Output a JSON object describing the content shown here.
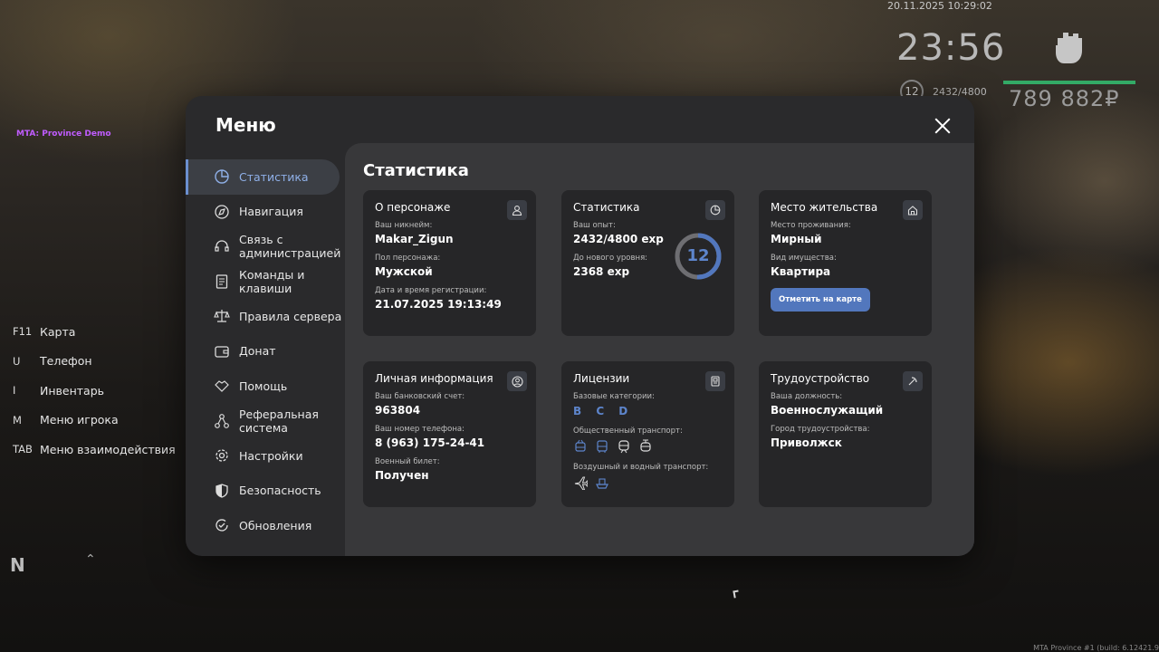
{
  "hud": {
    "datetime": "20.11.2025 10:29:02",
    "clock": "23:56",
    "level": "12",
    "exp": "2432/4800",
    "money": "789 882₽",
    "server_label": "MTA: Province Demo",
    "build": "MTA Province #1 (build: 6.12421.9",
    "compass": "N"
  },
  "hotkeys": [
    {
      "key": "F11",
      "label": "Карта"
    },
    {
      "key": "U",
      "label": "Телефон"
    },
    {
      "key": "I",
      "label": "Инвентарь"
    },
    {
      "key": "M",
      "label": "Меню игрока"
    },
    {
      "key": "TAB",
      "label": "Меню взаимодействия"
    }
  ],
  "menu": {
    "title": "Меню",
    "nav": [
      {
        "label": "Статистика",
        "icon": "pie-chart-icon"
      },
      {
        "label": "Навигация",
        "icon": "compass-icon"
      },
      {
        "label": "Связь с администрацией",
        "icon": "headset-icon"
      },
      {
        "label": "Команды и клавиши",
        "icon": "document-icon"
      },
      {
        "label": "Правила сервера",
        "icon": "scales-icon"
      },
      {
        "label": "Донат",
        "icon": "wallet-icon"
      },
      {
        "label": "Помощь",
        "icon": "handshake-icon"
      },
      {
        "label": "Реферальная система",
        "icon": "network-icon"
      },
      {
        "label": "Настройки",
        "icon": "gear-icon"
      },
      {
        "label": "Безопасность",
        "icon": "shield-icon"
      },
      {
        "label": "Обновления",
        "icon": "refresh-check-icon"
      }
    ],
    "content_title": "Статистика",
    "cards": {
      "character": {
        "title": "О персонаже",
        "nickname_label": "Ваш никнейм:",
        "nickname": "Makar_Zigun",
        "gender_label": "Пол персонажа:",
        "gender": "Мужской",
        "reg_label": "Дата и время регистрации:",
        "reg_date": "21.07.2025 19:13:49"
      },
      "stats": {
        "title": "Статистика",
        "exp_label": "Ваш опыт:",
        "exp": "2432/4800 exp",
        "next_label": "До нового уровня:",
        "next": "2368 exp",
        "level": "12",
        "progress": 0.507
      },
      "residence": {
        "title": "Место жительства",
        "place_label": "Место проживания:",
        "place": "Мирный",
        "property_label": "Вид имущества:",
        "property": "Квартира",
        "button": "Отметить на карте"
      },
      "personal": {
        "title": "Личная информация",
        "bank_label": "Ваш банковский счет:",
        "bank": "963804",
        "phone_label": "Ваш номер телефона:",
        "phone": "8 (963) 175-24-41",
        "military_label": "Военный билет:",
        "military": "Получен"
      },
      "licenses": {
        "title": "Лицензии",
        "base_label": "Базовые категории:",
        "base": "B C D",
        "public_label": "Общественный транспорт:",
        "air_label": "Воздушный и водный транспорт:"
      },
      "job": {
        "title": "Трудоустройство",
        "position_label": "Ваша должность:",
        "position": "Военнослужащий",
        "city_label": "Город трудоустройства:",
        "city": "Приволжск"
      }
    }
  }
}
